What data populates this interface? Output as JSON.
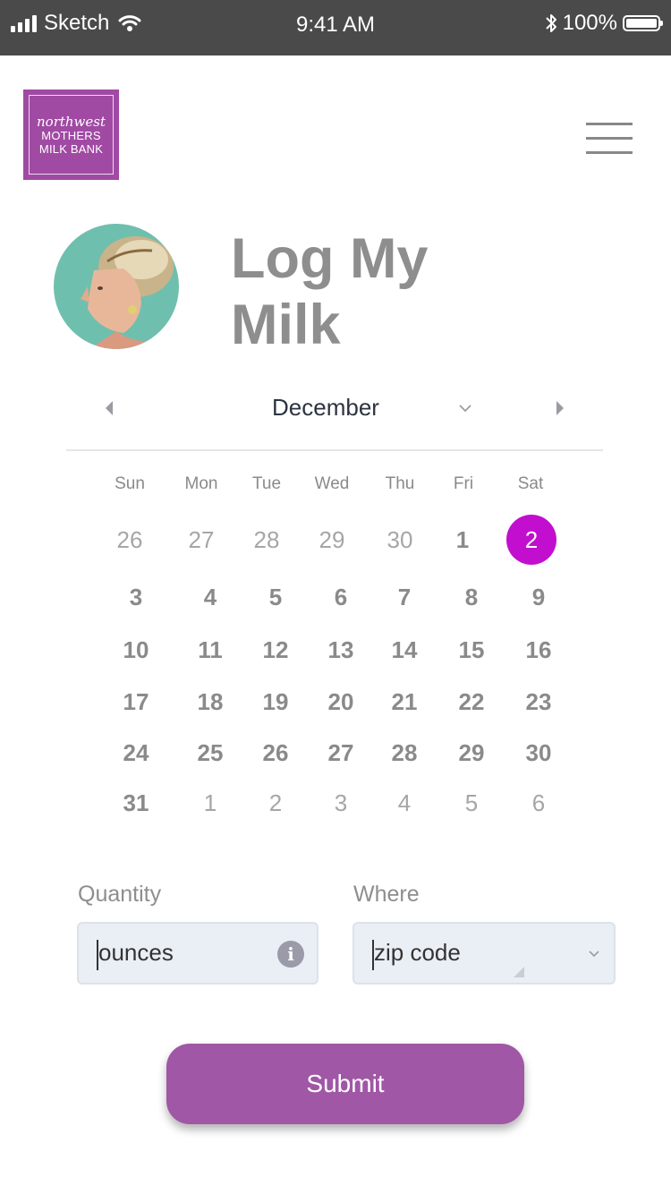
{
  "status_bar": {
    "carrier": "Sketch",
    "time": "9:41 AM",
    "battery": "100%"
  },
  "logo": {
    "line1": "northwest",
    "line2": "MOTHERS",
    "line3": "MILK BANK"
  },
  "page": {
    "title_line1": "Log My",
    "title_line2": "Milk"
  },
  "calendar": {
    "month": "December",
    "weekdays": [
      "Sun",
      "Mon",
      "Tue",
      "Wed",
      "Thu",
      "Fri",
      "Sat"
    ],
    "selected_day": "2",
    "weeks": [
      [
        {
          "d": "26",
          "cur": false
        },
        {
          "d": "27",
          "cur": false
        },
        {
          "d": "28",
          "cur": false
        },
        {
          "d": "29",
          "cur": false
        },
        {
          "d": "30",
          "cur": false
        },
        {
          "d": "1",
          "cur": true
        },
        {
          "d": "2",
          "cur": true,
          "sel": true
        }
      ],
      [
        {
          "d": "3",
          "cur": true
        },
        {
          "d": "4",
          "cur": true
        },
        {
          "d": "5",
          "cur": true
        },
        {
          "d": "6",
          "cur": true
        },
        {
          "d": "7",
          "cur": true
        },
        {
          "d": "8",
          "cur": true
        },
        {
          "d": "9",
          "cur": true
        }
      ],
      [
        {
          "d": "10",
          "cur": true
        },
        {
          "d": "11",
          "cur": true
        },
        {
          "d": "12",
          "cur": true
        },
        {
          "d": "13",
          "cur": true
        },
        {
          "d": "14",
          "cur": true
        },
        {
          "d": "15",
          "cur": true
        },
        {
          "d": "16",
          "cur": true
        }
      ],
      [
        {
          "d": "17",
          "cur": true
        },
        {
          "d": "18",
          "cur": true
        },
        {
          "d": "19",
          "cur": true
        },
        {
          "d": "20",
          "cur": true
        },
        {
          "d": "21",
          "cur": true
        },
        {
          "d": "22",
          "cur": true
        },
        {
          "d": "23",
          "cur": true
        }
      ],
      [
        {
          "d": "24",
          "cur": true
        },
        {
          "d": "25",
          "cur": true
        },
        {
          "d": "26",
          "cur": true
        },
        {
          "d": "27",
          "cur": true
        },
        {
          "d": "28",
          "cur": true
        },
        {
          "d": "29",
          "cur": true
        },
        {
          "d": "30",
          "cur": true
        }
      ],
      [
        {
          "d": "31",
          "cur": true
        },
        {
          "d": "1",
          "cur": false
        },
        {
          "d": "2",
          "cur": false
        },
        {
          "d": "3",
          "cur": false
        },
        {
          "d": "4",
          "cur": false
        },
        {
          "d": "5",
          "cur": false
        },
        {
          "d": "6",
          "cur": false
        }
      ]
    ]
  },
  "form": {
    "quantity_label": "Quantity",
    "quantity_placeholder": "ounces",
    "where_label": "Where",
    "where_placeholder": "zip code"
  },
  "submit_label": "Submit",
  "colors": {
    "accent": "#a057a6",
    "selected": "#c20fcf",
    "status_bar": "#4a4a4a",
    "text_gray": "#8e8e8e"
  }
}
